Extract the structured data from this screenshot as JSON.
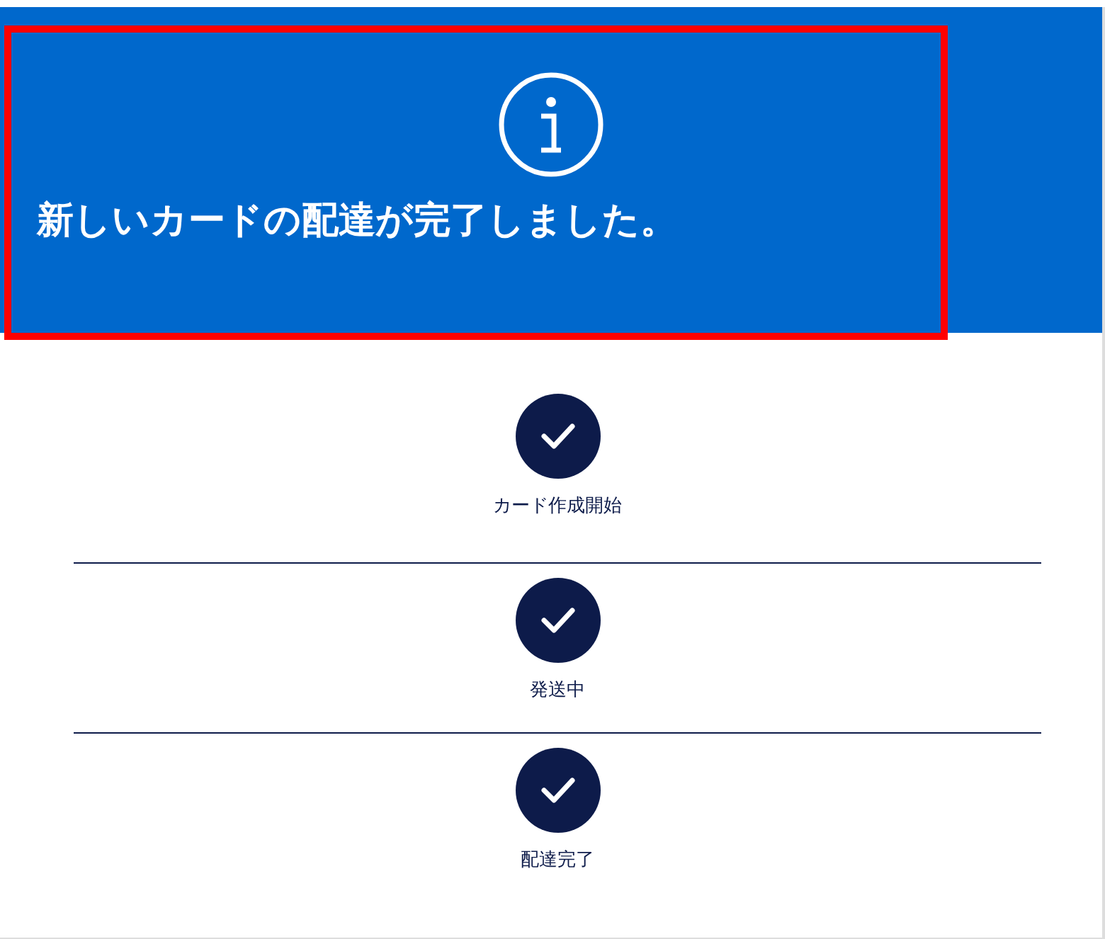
{
  "banner": {
    "title": "新しいカードの配達が完了しました。"
  },
  "steps": [
    {
      "label": "カード作成開始",
      "done": true
    },
    {
      "label": "発送中",
      "done": true
    },
    {
      "label": "配達完了",
      "done": true
    }
  ]
}
